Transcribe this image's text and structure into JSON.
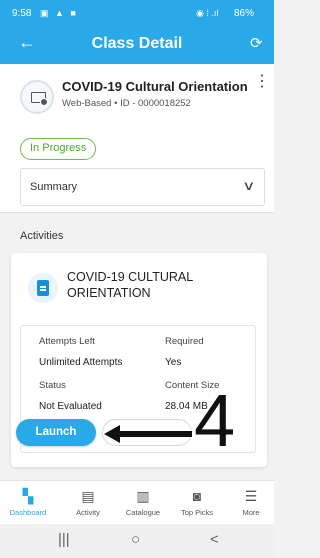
{
  "status_bar": {
    "time": "9:58",
    "battery": "86%"
  },
  "app_bar": {
    "title": "Class Detail",
    "back_icon": "arrow-left-icon",
    "refresh_icon": "refresh-icon"
  },
  "class": {
    "title": "COVID-19 Cultural Orientation",
    "subtitle": "Web-Based • ID - 0000018252",
    "status": "In Progress",
    "summary_label": "Summary"
  },
  "activities": {
    "section_title": "Activities",
    "items": [
      {
        "name": "COVID-19 CULTURAL ORIENTATION",
        "attempts_left_label": "Attempts Left",
        "attempts_left_value": "Unlimited Attempts",
        "required_label": "Required",
        "required_value": "Yes",
        "status_label": "Status",
        "status_value": "Not Evaluated",
        "content_size_label": "Content Size",
        "content_size_value": "28.04 MB",
        "launch_label": "Launch"
      }
    ]
  },
  "annotation": {
    "label": "4"
  },
  "bottom_nav": {
    "items": [
      {
        "label": "Dashboard",
        "icon": "dashboard-icon",
        "active": true
      },
      {
        "label": "Activity",
        "icon": "activity-icon",
        "active": false
      },
      {
        "label": "Catalogue",
        "icon": "catalogue-icon",
        "active": false
      },
      {
        "label": "Top Picks",
        "icon": "top-picks-icon",
        "active": false
      },
      {
        "label": "More",
        "icon": "menu-icon",
        "active": false
      }
    ]
  },
  "system_nav": {
    "recents": "|||",
    "home": "○",
    "back": "<"
  },
  "colors": {
    "primary": "#2aa9e8",
    "progress_green": "#4aa82a"
  }
}
